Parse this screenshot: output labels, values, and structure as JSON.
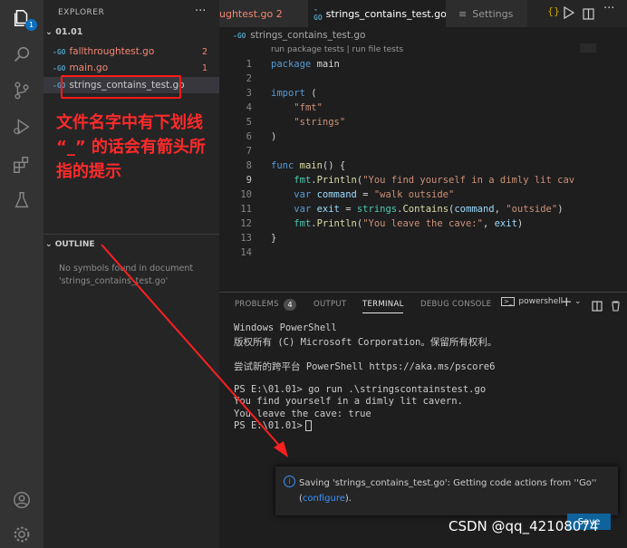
{
  "activity": {
    "badge": "1"
  },
  "explorer": {
    "title": "EXPLORER",
    "more": "···",
    "folder": "01.01",
    "files": [
      {
        "name": "fallthroughtest.go",
        "count": "2",
        "color": "#f48771"
      },
      {
        "name": "main.go",
        "count": "1",
        "color": "#f48771"
      },
      {
        "name": "strings_contains_test.go",
        "count": "",
        "color": "#cccccc"
      }
    ],
    "outline_title": "OUTLINE",
    "outline_msg": "No symbols found in document 'strings_contains_test.go'"
  },
  "tabs": [
    {
      "label": "ughtest.go",
      "count": "2"
    },
    {
      "label": "strings_contains_test.go",
      "dot": "●"
    },
    {
      "label": "Settings"
    }
  ],
  "editor": {
    "breadcrumb": "strings_contains_test.go",
    "codelens": "run package tests | run file tests",
    "line_numbers": [
      "1",
      "2",
      "3",
      "4",
      "5",
      "6",
      "7",
      "8",
      "9",
      "10",
      "11",
      "12",
      "13",
      "14"
    ]
  },
  "panel": {
    "tabs": [
      "PROBLEMS",
      "OUTPUT",
      "TERMINAL",
      "DEBUG CONSOLE"
    ],
    "problems_count": "4",
    "shell": "powershell",
    "terminal_lines": [
      "Windows PowerShell",
      "版权所有 (C) Microsoft Corporation。保留所有权利。",
      "",
      "尝试新的跨平台 PowerShell https://aka.ms/pscore6",
      "",
      "PS E:\\01.01> go run .\\stringscontainstest.go",
      "You find yourself in a dimly lit cavern.",
      "You leave the cave: true",
      "PS E:\\01.01> "
    ]
  },
  "notification": {
    "text": "Saving 'strings_contains_test.go': Getting code actions from ''Go''",
    "link": "configure",
    "button": "Save"
  },
  "annotation": {
    "text": "文件名字中有下划线 “_” 的话会有箭头所指的提示"
  },
  "watermark": "CSDN @qq_42108074",
  "colors": {
    "accent": "#007acc",
    "annotation": "#ff2a2a"
  }
}
